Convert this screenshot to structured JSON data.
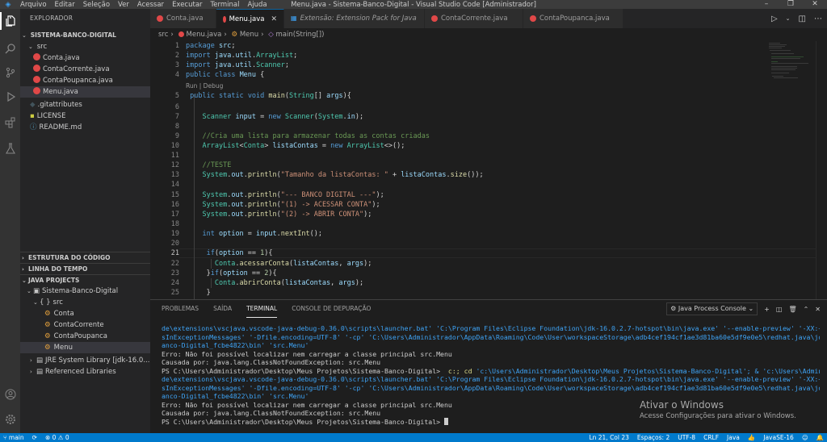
{
  "titlebar": {
    "menu": [
      "Arquivo",
      "Editar",
      "Seleção",
      "Ver",
      "Acessar",
      "Executar",
      "Terminal",
      "Ajuda"
    ],
    "title": "Menu.java - Sistema-Banco-Digital - Visual Studio Code [Administrador]",
    "minimize": "–",
    "restore": "❐",
    "close": "✕"
  },
  "activity": [
    "explorer-icon",
    "search-icon",
    "source-control-icon",
    "run-debug-icon",
    "extensions-icon",
    "test-icon",
    "account-icon",
    "settings-icon"
  ],
  "sidebar": {
    "header": "EXPLORADOR",
    "project": "SISTEMA-BANCO-DIGITAL",
    "src_folder": "src",
    "files": [
      "Conta.java",
      "ContaCorrente.java",
      "ContaPoupanca.java",
      "Menu.java"
    ],
    "root_files": [
      ".gitattributes",
      "LICENSE",
      "README.md"
    ],
    "sections": {
      "outline": "ESTRUTURA DO CÓDIGO",
      "timeline": "LINHA DO TEMPO",
      "java_projects": "JAVA PROJECTS"
    },
    "java_project": "Sistema-Banco-Digital",
    "java_src": "src",
    "java_classes": [
      "Conta",
      "ContaCorrente",
      "ContaPoupanca",
      "Menu"
    ],
    "jre": "JRE System Library [jdk-16.0...",
    "referenced": "Referenced Libraries"
  },
  "tabs": [
    {
      "label": "Conta.java",
      "kind": "java"
    },
    {
      "label": "Menu.java",
      "kind": "java",
      "active": true
    },
    {
      "label": "Extensão: Extension Pack for Java",
      "kind": "ext"
    },
    {
      "label": "ContaCorrente.java",
      "kind": "java"
    },
    {
      "label": "ContaPoupanca.java",
      "kind": "java"
    }
  ],
  "editor_actions": [
    "run-icon",
    "split-editor-icon",
    "more-icon"
  ],
  "breadcrumb": [
    "src",
    "Menu.java",
    "Menu",
    "main(String[])"
  ],
  "editor": {
    "codelens": "Run | Debug",
    "line_numbers": [
      "1",
      "2",
      "3",
      "4",
      "",
      "5",
      "6",
      "7",
      "8",
      "9",
      "10",
      "11",
      "12",
      "13",
      "14",
      "15",
      "16",
      "17",
      "18",
      "19",
      "20",
      "21",
      "22",
      "23",
      "24",
      "25"
    ],
    "current_line": "21",
    "lines": [
      "package src;",
      "import java.util.ArrayList;",
      "import java.util.Scanner;",
      "public class Menu {",
      "Run | Debug",
      " public static void main(String[] args){",
      "",
      "    Scanner input = new Scanner(System.in);",
      "",
      "    //Cria uma lista para armazenar todas as contas criadas",
      "    ArrayList<Conta> listaContas = new ArrayList<>();",
      "",
      "    //TESTE",
      "    System.out.println(\"Tamanho da listaContas: \" + listaContas.size());",
      "",
      "    System.out.println(\"--- BANCO DIGITAL ---\");",
      "    System.out.println(\"(1) -> ACESSAR CONTA\");",
      "    System.out.println(\"(2) -> ABRIR CONTA\");",
      "",
      "    int option = input.nextInt();",
      "",
      "     if(option == 1){",
      "       Conta.acessarConta(listaContas, args);",
      "     }if(option == 2){",
      "       Conta.abrirConta(listaContas, args);",
      "     }"
    ]
  },
  "panel": {
    "tabs": [
      "PROBLEMAS",
      "SAÍDA",
      "TERMINAL",
      "CONSOLE DE DEPURAÇÃO"
    ],
    "active_tab": "TERMINAL",
    "console_select": "Java Process Console",
    "terminal": [
      "de\\extensions\\vscjava.vscode-java-debug-0.36.0\\scripts\\launcher.bat' 'C:\\Program Files\\Eclipse Foundation\\jdk-16.0.2.7-hotspot\\bin\\java.exe' '--enable-preview' '-XX:+ShowCodeDetail",
      "sInExceptionMessages' '-Dfile.encoding=UTF-8' '-cp' 'C:\\Users\\Administrador\\AppData\\Roaming\\Code\\User\\workspaceStorage\\adb4cef194cf1ae3d81ba60e5df9e0e5\\redhat.java\\jdt_ws\\Sistema-B",
      "anco-Digital_fcbe4822\\bin' 'src.Menu'",
      "Erro: Não foi possível localizar nem carregar a classe principal src.Menu",
      "Causada por: java.lang.ClassNotFoundException: src.Menu",
      "PS C:\\Users\\Administrador\\Desktop\\Meus Projetos\\Sistema-Banco-Digital>  c:; cd 'c:\\Users\\Administrador\\Desktop\\Meus Projetos\\Sistema-Banco-Digital'; & 'c:\\Users\\Administrador\\.vsco",
      "de\\extensions\\vscjava.vscode-java-debug-0.36.0\\scripts\\launcher.bat' 'C:\\Program Files\\Eclipse Foundation\\jdk-16.0.2.7-hotspot\\bin\\java.exe' '--enable-preview' '-XX:+ShowCodeDetail",
      "sInExceptionMessages' '-Dfile.encoding=UTF-8' '-cp' 'C:\\Users\\Administrador\\AppData\\Roaming\\Code\\User\\workspaceStorage\\adb4cef194cf1ae3d81ba60e5df9e0e5\\redhat.java\\jdt_ws\\Sistema-B",
      "anco-Digital_fcbe4822\\bin' 'src.Menu'",
      "Erro: Não foi possível localizar nem carregar a classe principal src.Menu",
      "Causada por: java.lang.ClassNotFoundException: src.Menu",
      "PS C:\\Users\\Administrador\\Desktop\\Meus Projetos\\Sistema-Banco-Digital> "
    ],
    "activate_title": "Ativar o Windows",
    "activate_sub": "Acesse Configurações para ativar o Windows."
  },
  "status": {
    "branch": "main",
    "problems": "⊗ 0 ⚠ 0",
    "position": "Ln 21, Col 23",
    "spaces": "Espaços: 2",
    "encoding": "UTF-8",
    "eol": "CRLF",
    "language": "Java",
    "jdk": "JavaSE-16"
  },
  "colors": {
    "accent": "#007acc",
    "java_icon": "#e04848",
    "sidebar_bg": "#252526",
    "editor_bg": "#1e1e1e"
  }
}
